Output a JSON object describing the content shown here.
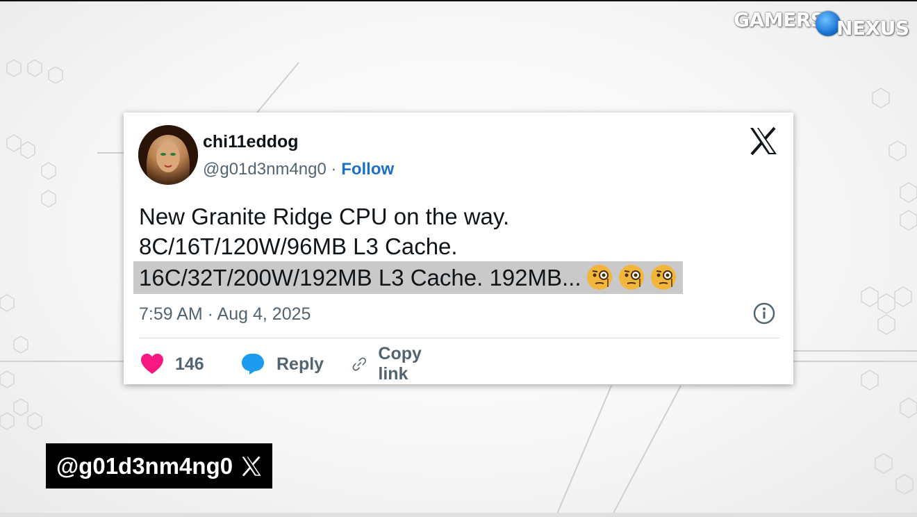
{
  "branding": {
    "logo_text_1": "GAMERS",
    "logo_text_2": "NEXUS"
  },
  "tweet": {
    "display_name": "chi11eddog",
    "handle": "@g01d3nm4ng0",
    "separator": "·",
    "follow_label": "Follow",
    "lines": [
      "New Granite Ridge CPU on the way.",
      "8C/16T/120W/96MB L3 Cache.",
      "16C/32T/200W/192MB L3 Cache. 192MB..."
    ],
    "emojis": [
      "face-with-monocle",
      "face-with-monocle",
      "face-with-monocle"
    ],
    "timestamp": "7:59 AM · Aug 4, 2025",
    "likes_count": "146",
    "reply_label": "Reply",
    "copy_link_label": "Copy link"
  },
  "caption": {
    "handle": "@g01d3nm4ng0"
  },
  "colors": {
    "follow_blue": "#1d6fc4",
    "like_pink": "#f91880",
    "reply_blue": "#1d9bf0",
    "highlight_gray": "#c9c9c9"
  },
  "icons": [
    "x-logo-icon",
    "info-icon",
    "heart-icon",
    "reply-bubble-icon",
    "link-icon",
    "globe-icon"
  ]
}
